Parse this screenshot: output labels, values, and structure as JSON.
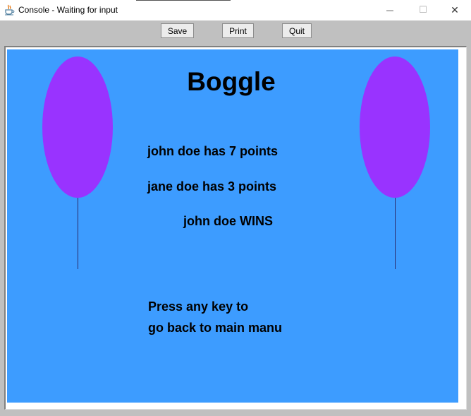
{
  "window": {
    "title": "Console - Waiting for input",
    "icon": "java-cup-icon",
    "controls": {
      "minimize": "—",
      "maximize": "☐",
      "close": "✕"
    }
  },
  "toolbar": {
    "save_label": "Save",
    "print_label": "Print",
    "quit_label": "Quit"
  },
  "game": {
    "title": "Boggle",
    "player1_score": "john doe has 7 points",
    "player2_score": "jane doe has 3 points",
    "winner": "john doe WINS",
    "prompt_line1": "Press any key to",
    "prompt_line2": "go back to main manu"
  },
  "colors": {
    "background": "#3d9cff",
    "balloon": "#9933ff"
  }
}
